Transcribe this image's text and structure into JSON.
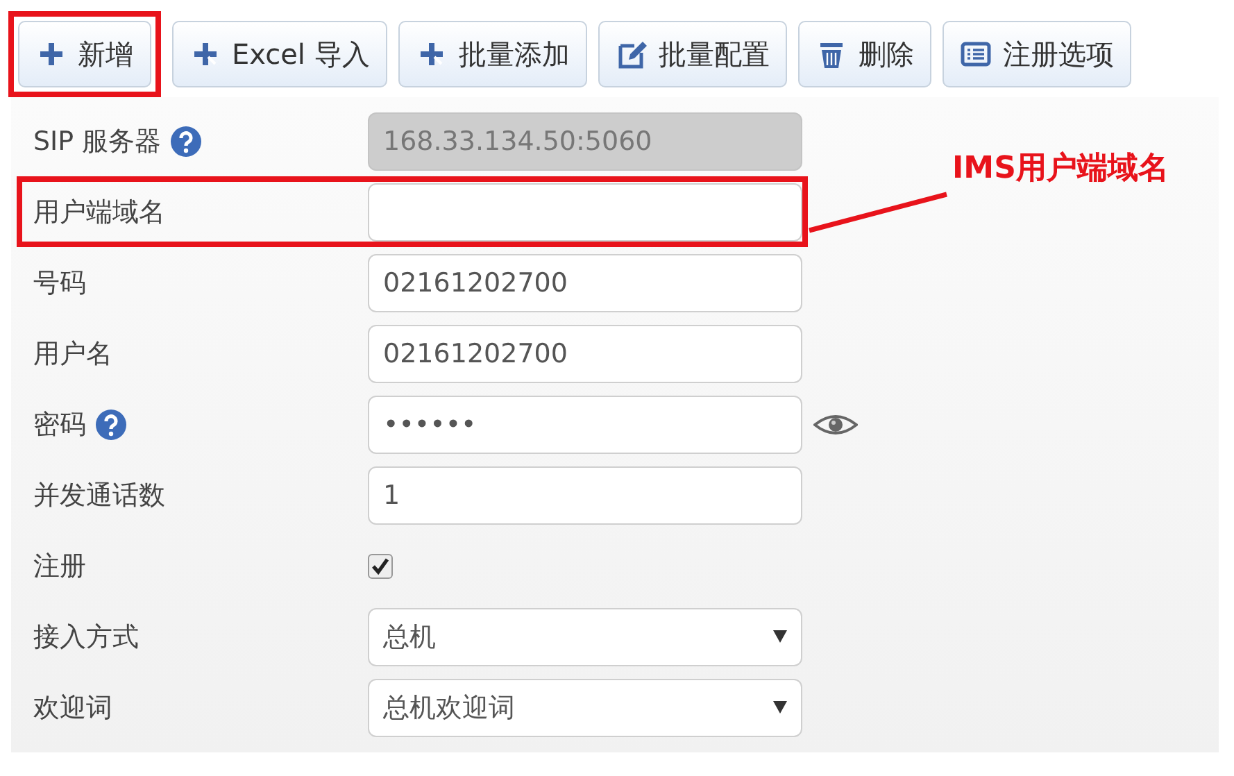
{
  "toolbar": [
    {
      "label": "新增",
      "highlighted": true
    },
    {
      "label": "Excel 导入",
      "highlighted": false
    },
    {
      "label": "批量添加",
      "highlighted": false
    },
    {
      "label": "批量配置",
      "highlighted": false
    },
    {
      "label": "删除",
      "highlighted": false
    },
    {
      "label": "注册选项",
      "highlighted": false
    }
  ],
  "form": [
    {
      "kind": "text",
      "label": "SIP 服务器",
      "help": true,
      "value": "168.33.134.50:5060",
      "disabled": true,
      "highlighted": false
    },
    {
      "kind": "text",
      "label": "用户端域名",
      "help": false,
      "disabled": false,
      "highlighted": true
    },
    {
      "kind": "text",
      "label": "号码",
      "help": false,
      "value": "02161202700",
      "disabled": false,
      "highlighted": false
    },
    {
      "kind": "text",
      "label": "用户名",
      "help": false,
      "value": "02161202700",
      "disabled": false,
      "highlighted": false
    },
    {
      "kind": "password",
      "label": "密码",
      "help": true,
      "value": "••••••",
      "disabled": false,
      "highlighted": false
    },
    {
      "kind": "text",
      "label": "并发通话数",
      "help": false,
      "value": "1",
      "disabled": false,
      "highlighted": false
    },
    {
      "kind": "checkbox",
      "label": "注册",
      "help": false,
      "checked": true,
      "highlighted": false
    },
    {
      "kind": "select",
      "label": "接入方式",
      "help": false,
      "value": "总机",
      "highlighted": false
    },
    {
      "kind": "select",
      "label": "欢迎词",
      "help": false,
      "value": "总机欢迎词",
      "highlighted": false
    }
  ],
  "annotation": {
    "text": "IMS用户端域名"
  }
}
